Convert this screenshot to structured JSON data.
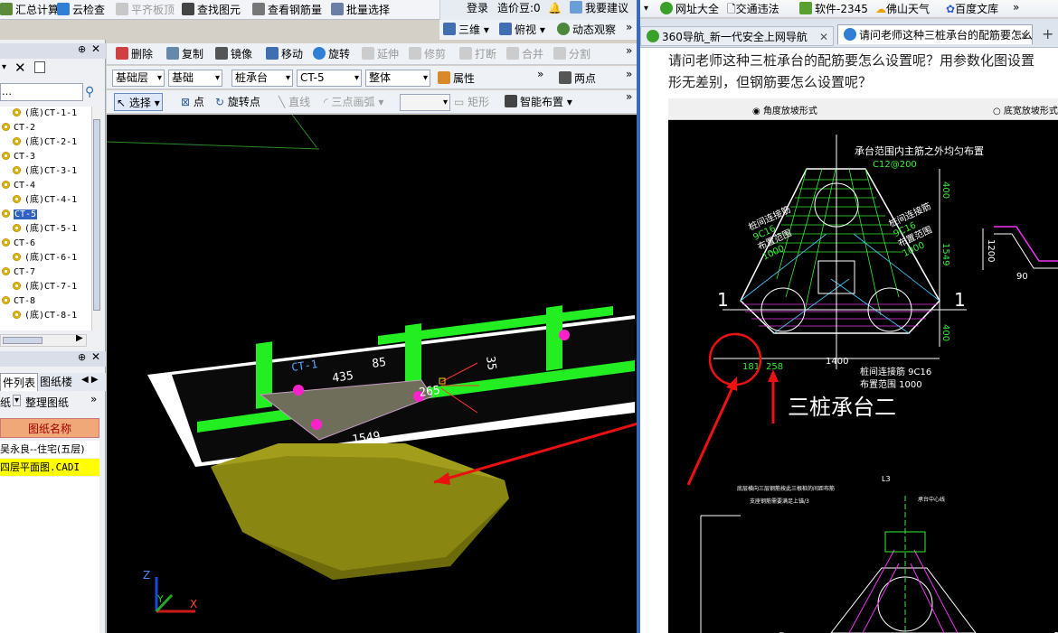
{
  "app_toolbar1": {
    "summary": "汇总计算",
    "cloud_check": "云检查",
    "flat_top": "平齐板顶",
    "find_element": "查找图元",
    "view_rebar": "查看钢筋量",
    "batch_select": "批量选择",
    "three_d": "三维",
    "top_view": "俯视",
    "dynamic_view": "动态观察"
  },
  "app_header_right": {
    "login": "登录",
    "price_label": "造价豆:0",
    "suggest": "我要建议"
  },
  "app_toolbar2": {
    "delete": "删除",
    "copy": "复制",
    "mirror": "镜像",
    "move": "移动",
    "rotate": "旋转",
    "extend": "延伸",
    "trim": "修剪",
    "break": "打断",
    "merge": "合并",
    "split": "分割"
  },
  "app_toolbar3": {
    "layer": "基础层",
    "category": "基础",
    "type": "桩承台",
    "element": "CT-5",
    "scope": "整体",
    "properties": "属性",
    "two_points": "两点"
  },
  "app_toolbar4": {
    "select": "选择",
    "point": "点",
    "rotate_point": "旋转点",
    "line": "直线",
    "arc": "三点画弧",
    "rect": "矩形",
    "smart_layout": "智能布置"
  },
  "tree": {
    "items": [
      {
        "label": "(底)CT-1-1",
        "child": true
      },
      {
        "label": "CT-2",
        "child": false
      },
      {
        "label": "(底)CT-2-1",
        "child": true
      },
      {
        "label": "CT-3",
        "child": false
      },
      {
        "label": "(底)CT-3-1",
        "child": true
      },
      {
        "label": "CT-4",
        "child": false
      },
      {
        "label": "(底)CT-4-1",
        "child": true
      },
      {
        "label": "CT-5",
        "child": false,
        "selected": true
      },
      {
        "label": "(底)CT-5-1",
        "child": true
      },
      {
        "label": "CT-6",
        "child": false
      },
      {
        "label": "(底)CT-6-1",
        "child": true
      },
      {
        "label": "CT-7",
        "child": false
      },
      {
        "label": "(底)CT-7-1",
        "child": true
      },
      {
        "label": "CT-8",
        "child": false
      },
      {
        "label": "(底)CT-8-1",
        "child": true
      }
    ],
    "search_placeholder": "…"
  },
  "bottom_panel": {
    "tab1": "件列表",
    "tab2": "图纸楼",
    "btn_paper": "纸",
    "btn_organize": "整理图纸",
    "col_header": "图纸名称",
    "rows": [
      "吴永良--住宅(五层)",
      "四层平面图.CADI"
    ]
  },
  "viewport": {
    "labels": {
      "ct": "CT-1",
      "d435": "435",
      "d85": "85",
      "d265": "265",
      "d1549": "1549",
      "d35": "35"
    },
    "axes": {
      "z": "Z",
      "y": "Y",
      "x": "X"
    }
  },
  "browser": {
    "favorites": [
      "网址大全",
      "交通违法",
      "软件-2345",
      "佛山天气",
      "百度文库"
    ],
    "tabs": [
      "360导航_新一代安全上网导航",
      "请问老师这种三桩承台的配筋要怎么设置呢?"
    ],
    "question_line1": "请问老师这种三桩承台的配筋要怎么设置呢？用参数化图设置",
    "question_line2": "形无差别，但钢筋要怎么设置呢？"
  },
  "drawing": {
    "radio1": "角度放坡形式",
    "radio2": "底宽放坡形式",
    "note_top": "承台范围内主筋之外均匀布置",
    "rebar_top": "C12@200",
    "left_label1": "桩间连接筋",
    "left_label2": "9C16",
    "left_label3": "布置范围",
    "left_label4": "1000",
    "right_label1": "桩间连接筋",
    "right_label2": "9C16",
    "right_label3": "布置范围",
    "right_label4": "1000",
    "bottom_label1": "桩间连接筋 9C16",
    "bottom_label2": "布置范围 1000",
    "dims": {
      "d400a": "400",
      "d1549": "1549",
      "d400b": "400",
      "d181": "181",
      "d258": "258",
      "d1400": "1400",
      "d1200": "1200",
      "d90": "90"
    },
    "section_mark": "1",
    "title": "三桩承台二",
    "lower_note1": "底层横向三层钢筋按此三根桩的间距布筋",
    "lower_note2": "支座钢筋需要满足上锚/3",
    "lower_label": "承台中心线",
    "lower_dim": "L3",
    "lower_circle": "①",
    "lower_right_dim": "1"
  }
}
